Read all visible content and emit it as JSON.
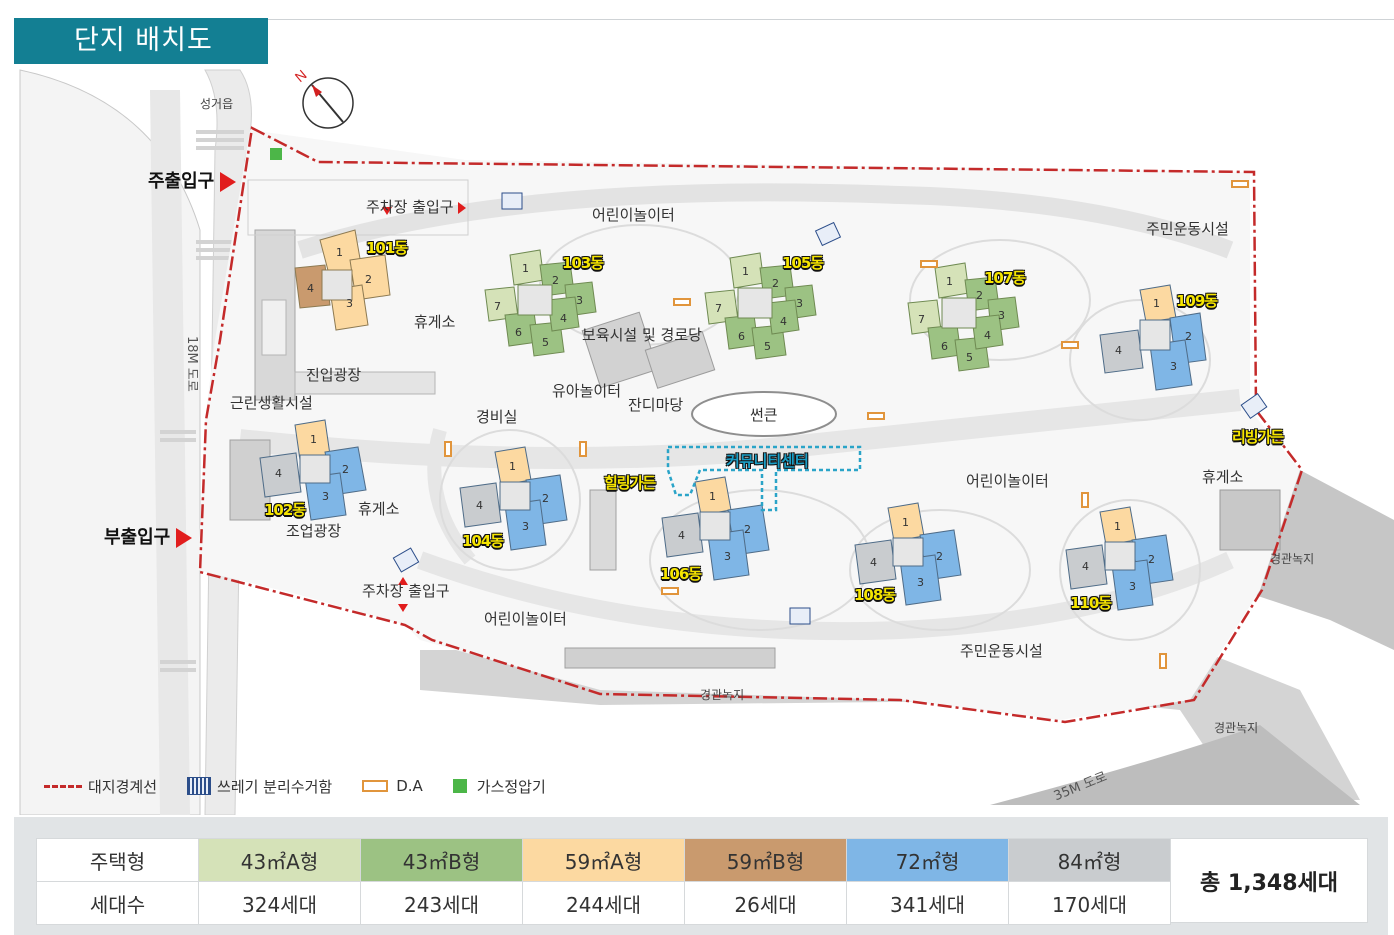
{
  "title": "단지 배치도",
  "compass": "N",
  "entrances": {
    "main": "주출입구",
    "sub": "부출입구",
    "parking_top": "주차장 출입구",
    "parking_bottom": "주차장 출입구"
  },
  "roads": {
    "w18": "18M 도로",
    "m35": "35M 도로",
    "north": "성거읍"
  },
  "facilities": {
    "playground_top": "어린이놀이터",
    "resident_sports_top": "주민운동시설",
    "rest_area_1": "휴게소",
    "childcare": "보육시설 및 경로당",
    "entry_plaza": "진입광장",
    "kids_playground": "유아놀이터",
    "lawn_yard": "잔디마당",
    "neighborhood": "근린생활시설",
    "guard_room": "경비실",
    "sunken": "썬큰",
    "community_center": "커뮤니티센터",
    "healing_garden": "힐링가든",
    "living_garden": "리빙가든",
    "playground_right": "어린이놀이터",
    "rest_area_right": "휴게소",
    "rest_area_left": "휴게소",
    "jogup_plaza": "조업광장",
    "playground_bottom": "어린이놀이터",
    "resident_sports_bottom": "주민운동시설",
    "landscape_bottom": "경관녹지",
    "landscape_right": "경관녹지",
    "landscape_corner": "경관녹지"
  },
  "buildings": [
    "101동",
    "102동",
    "103동",
    "104동",
    "105동",
    "106동",
    "107동",
    "108동",
    "109동",
    "110동"
  ],
  "legend": {
    "boundary": "대지경계선",
    "trash": "쓰레기 분리수거함",
    "da": "D.A",
    "gas": "가스정압기"
  },
  "colors": {
    "t43A": "#d5e2b8",
    "t43B": "#9cc283",
    "t59A": "#fcd9a1",
    "t59B": "#c99a6e",
    "t72": "#7fb6e6",
    "t84": "#c9cccf",
    "title_bg": "#137f93",
    "boundary": "#c42a2a"
  },
  "table": {
    "row1_label": "주택형",
    "row2_label": "세대수",
    "types": [
      "43㎡A형",
      "43㎡B형",
      "59㎡A형",
      "59㎡B형",
      "72㎡형",
      "84㎡형"
    ],
    "counts": [
      "324세대",
      "243세대",
      "244세대",
      "26세대",
      "341세대",
      "170세대"
    ],
    "total": "총 1,348세대"
  }
}
